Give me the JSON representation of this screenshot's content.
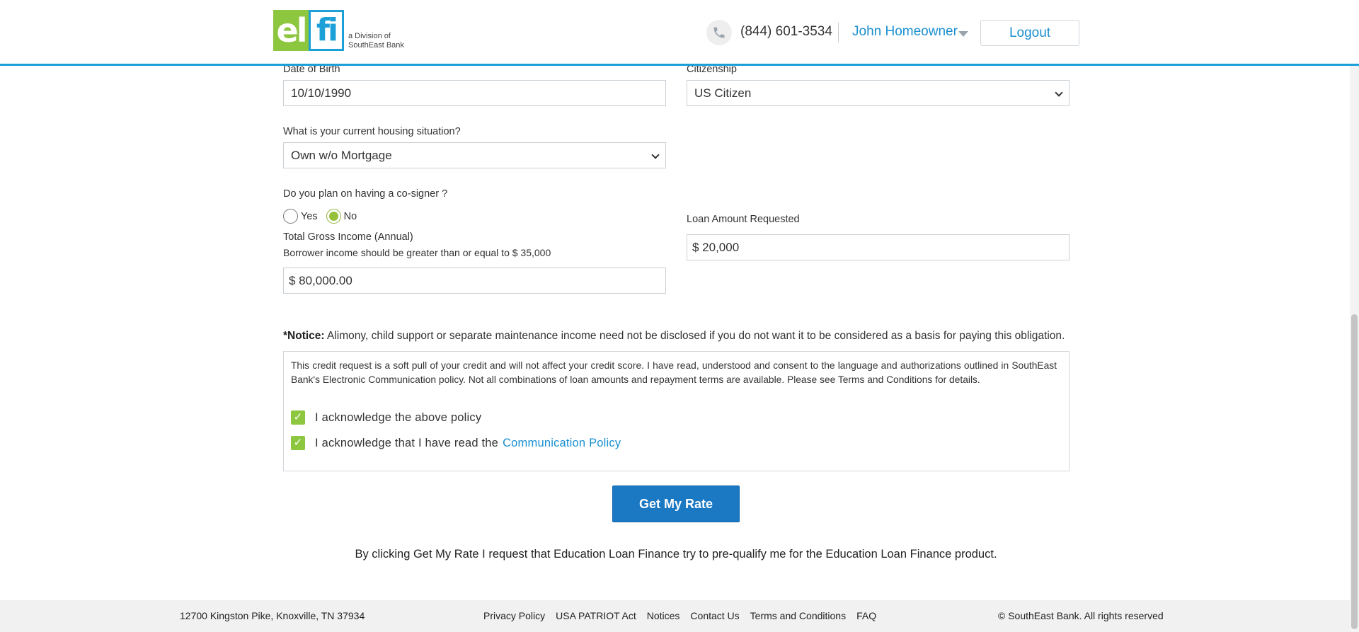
{
  "header": {
    "logo_left": "el",
    "logo_right": "fi",
    "logo_sub_line1": "a Division of",
    "logo_sub_line2": "SouthEast Bank",
    "phone": "(844) 601-3534",
    "user_name": "John Homeowner",
    "logout_label": "Logout"
  },
  "form": {
    "dob_label": "Date of Birth",
    "dob_value": "10/10/1990",
    "citizenship_label": "Citizenship",
    "citizenship_value": "US Citizen",
    "housing_label": "What is your current housing situation?",
    "housing_value": "Own w/o Mortgage",
    "cosigner_label": "Do you plan on having a co-signer ?",
    "cosigner_yes": "Yes",
    "cosigner_no": "No",
    "cosigner_selected": "No",
    "income_label": "Total Gross Income (Annual)",
    "income_hint": "Borrower income should be greater than or equal to $ 35,000",
    "income_value": "$ 80,000.00",
    "loan_label": "Loan Amount Requested",
    "loan_value": "$ 20,000"
  },
  "notice": {
    "prefix": "*Notice:",
    "text": " Alimony, child support or separate maintenance income need not be disclosed if you do not want it to be considered as a basis for paying this obligation."
  },
  "consent": {
    "text": "This credit request is a soft pull of your credit and will not affect your credit score. I have read, understood and consent to the language and authorizations outlined in SouthEast Bank's Electronic Communication policy. Not all combinations of loan amounts and repayment terms are available. Please see Terms and Conditions for details.",
    "ack1": "I acknowledge the above policy",
    "ack2": "I acknowledge that I have read the",
    "ack2_link": "Communication Policy",
    "check_glyph": "✓"
  },
  "cta_label": "Get My Rate",
  "disclaimer": "By clicking Get My Rate I request that Education Loan Finance try to pre-qualify me for the Education Loan Finance product.",
  "footer": {
    "address": "12700 Kingston Pike, Knoxville, TN 37934",
    "links": [
      "Privacy Policy",
      "USA PATRIOT Act",
      "Notices",
      "Contact Us",
      "Terms and Conditions",
      "FAQ"
    ],
    "copyright": "© SouthEast Bank. All rights reserved"
  },
  "colors": {
    "brand_blue": "#1ca0d8",
    "brand_green": "#8dc63f",
    "cta_blue": "#1b78c2",
    "link_blue": "#1a8fd0"
  }
}
